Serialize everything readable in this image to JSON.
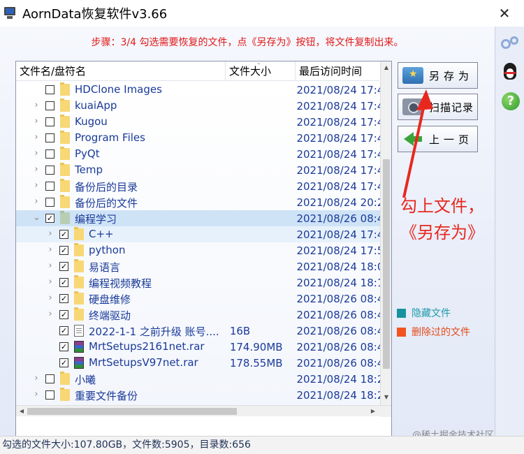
{
  "window": {
    "title": "AornData恢复软件v3.66",
    "close": "✕"
  },
  "step": "步骤：3/4 勾选需要恢复的文件，点《另存为》按钮，将文件复制出来。",
  "table": {
    "headers": {
      "name": "文件名/盘符名",
      "size": "文件大小",
      "date": "最后访问时间"
    },
    "rows": [
      {
        "name": "HDClone Images",
        "size": "",
        "date": "2021/08/24 17:4",
        "checked": false,
        "expand": "",
        "indent": 0,
        "icon": "folder"
      },
      {
        "name": "kuaiApp",
        "size": "",
        "date": "2021/08/24 17:4",
        "checked": false,
        "expand": "›",
        "indent": 0,
        "icon": "folder"
      },
      {
        "name": "Kugou",
        "size": "",
        "date": "2021/08/24 17:4",
        "checked": false,
        "expand": "›",
        "indent": 0,
        "icon": "folder"
      },
      {
        "name": "Program Files",
        "size": "",
        "date": "2021/08/24 17:4",
        "checked": false,
        "expand": "›",
        "indent": 0,
        "icon": "folder"
      },
      {
        "name": "PyQt",
        "size": "",
        "date": "2021/08/24 17:4",
        "checked": false,
        "expand": "›",
        "indent": 0,
        "icon": "folder"
      },
      {
        "name": "Temp",
        "size": "",
        "date": "2021/08/24 17:4",
        "checked": false,
        "expand": "›",
        "indent": 0,
        "icon": "folder"
      },
      {
        "name": "备份后的目录",
        "size": "",
        "date": "2021/08/24 17:4",
        "checked": false,
        "expand": "›",
        "indent": 0,
        "icon": "folder"
      },
      {
        "name": "备份后的文件",
        "size": "",
        "date": "2021/08/24 20:2",
        "checked": false,
        "expand": "›",
        "indent": 0,
        "icon": "folder"
      },
      {
        "name": "编程学习",
        "size": "",
        "date": "2021/08/26 08:4",
        "checked": true,
        "expand": "⌄",
        "indent": 0,
        "icon": "folder-grey",
        "selected": true
      },
      {
        "name": "C++",
        "size": "",
        "date": "2021/08/24 17:4",
        "checked": true,
        "expand": "›",
        "indent": 1,
        "icon": "folder",
        "childbg": true
      },
      {
        "name": "python",
        "size": "",
        "date": "2021/08/24 17:5",
        "checked": true,
        "expand": "›",
        "indent": 1,
        "icon": "folder"
      },
      {
        "name": "易语言",
        "size": "",
        "date": "2021/08/24 18:0",
        "checked": true,
        "expand": "›",
        "indent": 1,
        "icon": "folder"
      },
      {
        "name": "编程视频教程",
        "size": "",
        "date": "2021/08/24 18:1",
        "checked": true,
        "expand": "›",
        "indent": 1,
        "icon": "folder"
      },
      {
        "name": "硬盘维修",
        "size": "",
        "date": "2021/08/26 08:4",
        "checked": true,
        "expand": "›",
        "indent": 1,
        "icon": "folder"
      },
      {
        "name": "终端驱动",
        "size": "",
        "date": "2021/08/26 08:4",
        "checked": true,
        "expand": "›",
        "indent": 1,
        "icon": "folder"
      },
      {
        "name": "2022-1-1 之前升级 账号....",
        "size": "16B",
        "date": "2021/08/26 08:4",
        "checked": true,
        "expand": "",
        "indent": 1,
        "icon": "txt"
      },
      {
        "name": "MrtSetups2161net.rar",
        "size": "174.90MB",
        "date": "2021/08/26 08:4",
        "checked": true,
        "expand": "",
        "indent": 1,
        "icon": "rar"
      },
      {
        "name": "MrtSetupsV97net.rar",
        "size": "178.55MB",
        "date": "2021/08/26 08:4",
        "checked": true,
        "expand": "",
        "indent": 1,
        "icon": "rar"
      },
      {
        "name": "小曦",
        "size": "",
        "date": "2021/08/24 18:2",
        "checked": false,
        "expand": "›",
        "indent": 0,
        "icon": "folder"
      },
      {
        "name": "重要文件备份",
        "size": "",
        "date": "2021/08/24 18:2",
        "checked": false,
        "expand": "›",
        "indent": 0,
        "icon": "folder"
      }
    ]
  },
  "buttons": {
    "save": "另存为",
    "scan": "扫描记录",
    "prev": "上一页"
  },
  "annotation": {
    "line1": "勾上文件，",
    "line2": "《另存为》"
  },
  "legend": {
    "hidden": "隐藏文件",
    "deleted": "删除过的文件",
    "hidden_color": "#18939e",
    "deleted_color": "#f2541f"
  },
  "status": "勾选的文件大小:107.80GB，文件数:5905，目录数:656",
  "watermark": "@稀土掘金技术社区",
  "icons": {
    "app": "computer-monitor-icon",
    "gear": "gear-icon",
    "qq": "penguin-icon",
    "help": "help-icon"
  }
}
